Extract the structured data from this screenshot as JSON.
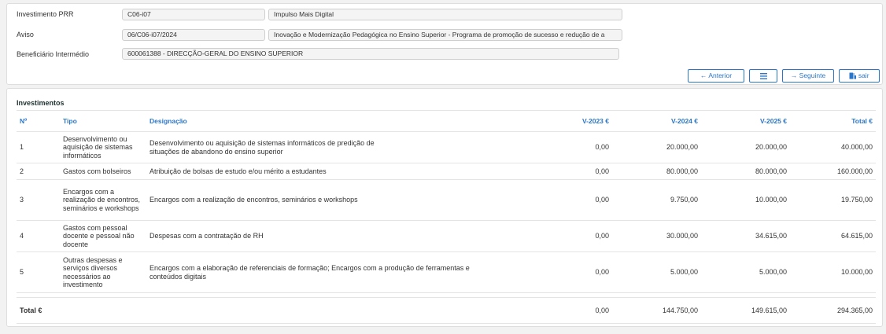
{
  "header": {
    "fields": [
      {
        "label": "Investimento PRR",
        "code": "C06-i07",
        "description": "Impulso Mais Digital"
      },
      {
        "label": "Aviso",
        "code": "06/C06-i07/2024",
        "description": "Inovação e Modernização Pedagógica no Ensino Superior - Programa de promoção de sucesso e redução de a"
      },
      {
        "label": "Beneficiário Intermédio",
        "value": "600061388 - DIRECÇÃO-GERAL DO ENSINO SUPERIOR"
      }
    ]
  },
  "toolbar": {
    "previous_label": "Anterior",
    "menu_icon": "list-icon",
    "next_label": "Seguinte",
    "exit_label": "sair",
    "accent_color": "#2a77c9"
  },
  "investments": {
    "title": "Investimentos",
    "columns": [
      "Nº",
      "Tipo",
      "Designação",
      "V-2023 €",
      "V-2024 €",
      "V-2025 €",
      "Total €"
    ],
    "rows": [
      {
        "n": "1",
        "tipo": "Desenvolvimento ou aquisição de sistemas informáticos",
        "designacao": "Desenvolvimento ou aquisição de sistemas informáticos de predição de situações de abandono do ensino superior",
        "v2023": "0,00",
        "v2024": "20.000,00",
        "v2025": "20.000,00",
        "total": "40.000,00"
      },
      {
        "n": "2",
        "tipo": "Gastos com bolseiros",
        "designacao": "Atribuição de bolsas de estudo e/ou mérito a estudantes",
        "v2023": "0,00",
        "v2024": "80.000,00",
        "v2025": "80.000,00",
        "total": "160.000,00"
      },
      {
        "n": "3",
        "tipo": "Encargos com a realização de encontros, seminários e workshops",
        "designacao": "Encargos com a realização de encontros, seminários e workshops",
        "v2023": "0,00",
        "v2024": "9.750,00",
        "v2025": "10.000,00",
        "total": "19.750,00"
      },
      {
        "n": "4",
        "tipo": "Gastos com pessoal docente e pessoal não docente",
        "designacao": "Despesas com a contratação de RH",
        "v2023": "0,00",
        "v2024": "30.000,00",
        "v2025": "34.615,00",
        "total": "64.615,00"
      },
      {
        "n": "5",
        "tipo": "Outras despesas e serviços diversos necessários ao investimento",
        "designacao": "Encargos com a elaboração de referenciais de formação; Encargos com a produção de ferramentas e conteúdos digitais",
        "v2023": "0,00",
        "v2024": "5.000,00",
        "v2025": "5.000,00",
        "total": "10.000,00"
      }
    ],
    "totals": {
      "label": "Total €",
      "v2023": "0,00",
      "v2024": "144.750,00",
      "v2025": "149.615,00",
      "total": "294.365,00"
    }
  }
}
